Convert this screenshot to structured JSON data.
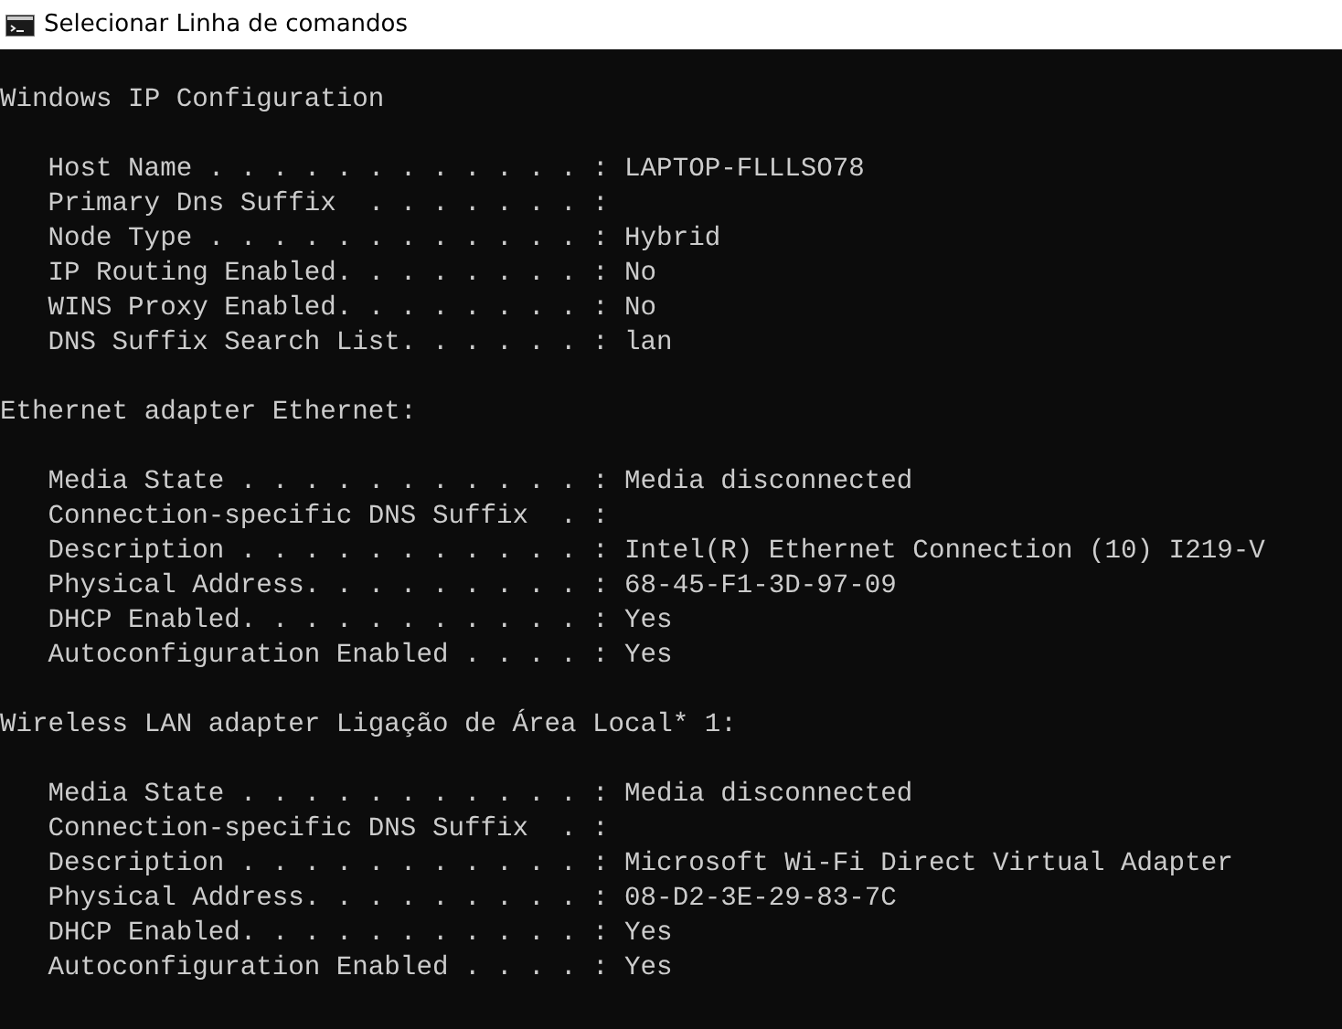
{
  "window": {
    "title": "Selecionar Linha de comandos"
  },
  "sections": [
    {
      "heading": "Windows IP Configuration",
      "rows": [
        {
          "label": "Host Name . . . . . . . . . . . . :",
          "value": "LAPTOP-FLLLSO78"
        },
        {
          "label": "Primary Dns Suffix  . . . . . . . :"
        },
        {
          "label": "Node Type . . . . . . . . . . . . :",
          "value": "Hybrid"
        },
        {
          "label": "IP Routing Enabled. . . . . . . . :",
          "value": "No"
        },
        {
          "label": "WINS Proxy Enabled. . . . . . . . :",
          "value": "No"
        },
        {
          "label": "DNS Suffix Search List. . . . . . :",
          "value": "lan"
        }
      ]
    },
    {
      "heading": "Ethernet adapter Ethernet:",
      "rows": [
        {
          "label": "Media State . . . . . . . . . . . :",
          "value": "Media disconnected"
        },
        {
          "label": "Connection-specific DNS Suffix  . :"
        },
        {
          "label": "Description . . . . . . . . . . . :",
          "value": "Intel(R) Ethernet Connection (10) I219-V"
        },
        {
          "label": "Physical Address. . . . . . . . . :",
          "value": "68-45-F1-3D-97-09"
        },
        {
          "label": "DHCP Enabled. . . . . . . . . . . :",
          "value": "Yes"
        },
        {
          "label": "Autoconfiguration Enabled . . . . :",
          "value": "Yes"
        }
      ]
    },
    {
      "heading": "Wireless LAN adapter Ligação de Área Local* 1:",
      "rows": [
        {
          "label": "Media State . . . . . . . . . . . :",
          "value": "Media disconnected"
        },
        {
          "label": "Connection-specific DNS Suffix  . :"
        },
        {
          "label": "Description . . . . . . . . . . . :",
          "value": "Microsoft Wi-Fi Direct Virtual Adapter"
        },
        {
          "label": "Physical Address. . . . . . . . . :",
          "value": "08-D2-3E-29-83-7C"
        },
        {
          "label": "DHCP Enabled. . . . . . . . . . . :",
          "value": "Yes"
        },
        {
          "label": "Autoconfiguration Enabled . . . . :",
          "value": "Yes"
        }
      ]
    }
  ]
}
